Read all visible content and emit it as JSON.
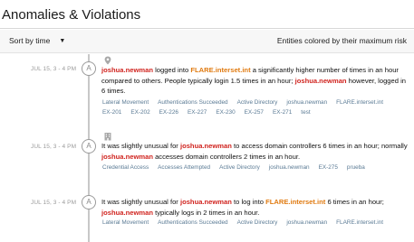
{
  "panel": {
    "title": "Anomalies & Violations",
    "sort_label": "Sort by time",
    "legend_note": "Entities colored by their maximum risk"
  },
  "colors": {
    "user_entity": "#d0231e",
    "host_entity": "#e07a10",
    "tag_text": "#5a7a94",
    "timestamp": "#9a9a9a"
  },
  "entries": [
    {
      "time": "JUL 15, 3 - 4 PM",
      "avatar": "A",
      "icon": "location-pin-icon",
      "parts": [
        {
          "t": "joshua.newman",
          "k": "user"
        },
        {
          "t": " logged into ",
          "k": "text"
        },
        {
          "t": "FLARE.interset.int",
          "k": "host"
        },
        {
          "t": " a significantly higher number of times in an hour compared to others. People typically login 1.5 times in an hour; ",
          "k": "text"
        },
        {
          "t": "joshua.newman",
          "k": "user"
        },
        {
          "t": " however, logged in 6 times.",
          "k": "text"
        }
      ],
      "tags": [
        "Lateral Movement",
        "Authentications Succeeded",
        "Active Directory",
        "joshua.newman",
        "FLARE.interset.int",
        "EX-201",
        "EX-202",
        "EX-226",
        "EX-227",
        "EX-230",
        "EX-257",
        "EX-271",
        "test"
      ]
    },
    {
      "time": "JUL 15, 3 - 4 PM",
      "avatar": "A",
      "icon": "building-icon",
      "parts": [
        {
          "t": "It was slightly unusual for ",
          "k": "text"
        },
        {
          "t": "joshua.newman",
          "k": "user"
        },
        {
          "t": " to access domain controllers 6 times in an hour; normally ",
          "k": "text"
        },
        {
          "t": "joshua.newman",
          "k": "user"
        },
        {
          "t": " accesses domain controllers 2 times in an hour.",
          "k": "text"
        }
      ],
      "tags": [
        "Credential Access",
        "Accesses Attempted",
        "Active Directory",
        "joshua.newman",
        "EX-275",
        "prueba"
      ]
    },
    {
      "time": "JUL 15, 3 - 4 PM",
      "avatar": "A",
      "icon": "",
      "parts": [
        {
          "t": "It was slightly unusual for ",
          "k": "text"
        },
        {
          "t": "joshua.newman",
          "k": "user"
        },
        {
          "t": " to log into ",
          "k": "text"
        },
        {
          "t": "FLARE.interset.int",
          "k": "host"
        },
        {
          "t": " 6 times in an hour; ",
          "k": "text"
        },
        {
          "t": "joshua.newman",
          "k": "user"
        },
        {
          "t": " typically logs in 2 times in an hour.",
          "k": "text"
        }
      ],
      "tags": [
        "Lateral Movement",
        "Authentications Succeeded",
        "Active Directory",
        "joshua.newman",
        "FLARE.interset.int"
      ]
    }
  ]
}
